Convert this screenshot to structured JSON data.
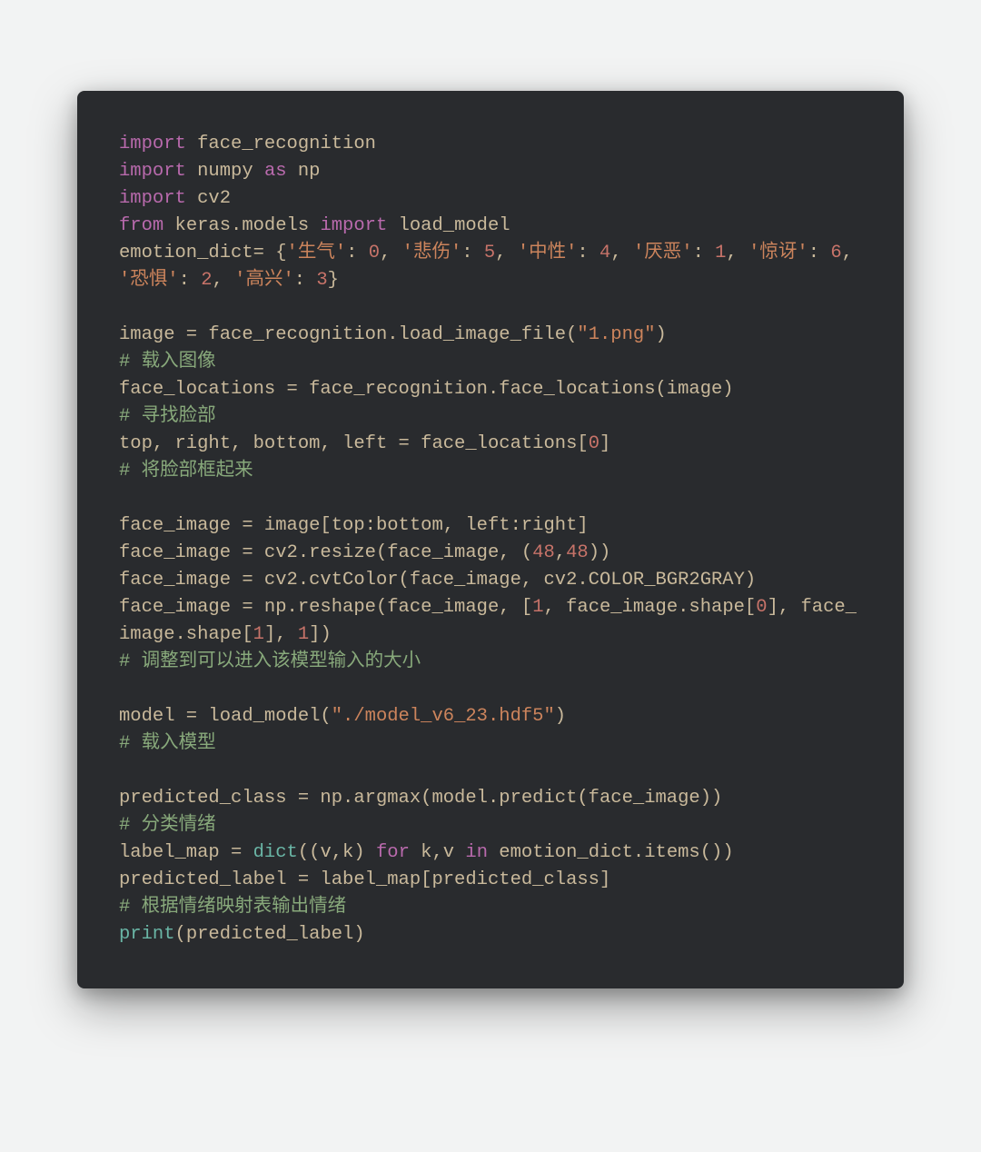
{
  "code": {
    "l1a": "import",
    "l1b": " face_recognition",
    "l2a": "import",
    "l2b": " numpy ",
    "l2c": "as",
    "l2d": " np",
    "l3a": "import",
    "l3b": " cv2",
    "l4a": "from",
    "l4b": " keras.models ",
    "l4c": "import",
    "l4d": " load_model",
    "l5a": "emotion_dict= {",
    "l5b": "'生气'",
    "l5c": ": ",
    "l5d": "0",
    "l5e": ", ",
    "l5f": "'悲伤'",
    "l5g": ": ",
    "l5h": "5",
    "l5i": ", ",
    "l5j": "'中性'",
    "l5k": ": ",
    "l5l": "4",
    "l5m": ", ",
    "l5n": "'厌恶'",
    "l5o": ": ",
    "l5p": "1",
    "l5q": ", ",
    "l5r": "'惊讶'",
    "l5s": ": ",
    "l5t": "6",
    "l5u": ", ",
    "l5v": "'恐惧'",
    "l5w": ": ",
    "l5x": "2",
    "l5y": ", ",
    "l5z": "'高兴'",
    "l5aa": ": ",
    "l5ab": "3",
    "l5ac": "}",
    "l6": "",
    "l7a": "image = face_recognition.load_image_file(",
    "l7b": "\"1.png\"",
    "l7c": ")",
    "l8": "# 载入图像",
    "l9": "face_locations = face_recognition.face_locations(image)",
    "l10": "# 寻找脸部",
    "l11a": "top, right, bottom, left = face_locations[",
    "l11b": "0",
    "l11c": "]",
    "l12": "# 将脸部框起来",
    "l13": "",
    "l14": "face_image = image[top:bottom, left:right]",
    "l15a": "face_image = cv2.resize(face_image, (",
    "l15b": "48",
    "l15c": ",",
    "l15d": "48",
    "l15e": "))",
    "l16": "face_image = cv2.cvtColor(face_image, cv2.COLOR_BGR2GRAY)",
    "l17a": "face_image = np.reshape(face_image, [",
    "l17b": "1",
    "l17c": ", face_image.shape[",
    "l17d": "0",
    "l17e": "], face_image.shape[",
    "l17f": "1",
    "l17g": "], ",
    "l17h": "1",
    "l17i": "])",
    "l18": "# 调整到可以进入该模型输入的大小",
    "l19": "",
    "l20a": "model = load_model(",
    "l20b": "\"./model_v6_23.hdf5\"",
    "l20c": ")",
    "l21": "# 载入模型",
    "l22": "",
    "l23": "predicted_class = np.argmax(model.predict(face_image))",
    "l24": "# 分类情绪",
    "l25a": "label_map = ",
    "l25b": "dict",
    "l25c": "((v,k) ",
    "l25d": "for",
    "l25e": " k,v ",
    "l25f": "in",
    "l25g": " emotion_dict.items())",
    "l26": "predicted_label = label_map[predicted_class]",
    "l27": "# 根据情绪映射表输出情绪",
    "l28a": "print",
    "l28b": "(predicted_label)"
  }
}
